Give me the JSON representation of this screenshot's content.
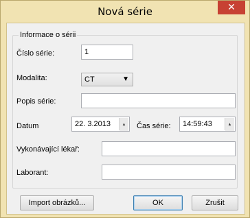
{
  "window": {
    "title": "Nová série",
    "close_glyph": "✕"
  },
  "group": {
    "legend": "Informace o sérii"
  },
  "fields": {
    "cislo_label": "Číslo série:",
    "cislo_value": "1",
    "modalita_label": "Modalita:",
    "modalita_value": "CT",
    "popis_label": "Popis série:",
    "popis_value": "",
    "datum_label": "Datum",
    "datum_value": "22.  3.2013",
    "cas_label": "Čas série:",
    "cas_value": "14:59:43",
    "lekar_label": "Vykonávající lékař:",
    "lekar_value": "",
    "laborant_label": "Laborant:",
    "laborant_value": ""
  },
  "buttons": {
    "import": "Import obrázků...",
    "ok": "OK",
    "cancel": "Zrušit"
  },
  "icons": {
    "close": "close-icon",
    "dropdown": "chevron-down-icon",
    "spin": "spin-arrows-icon"
  },
  "colors": {
    "frame": "#f1e3b2",
    "close": "#c74133",
    "client": "#f0f0f0"
  }
}
